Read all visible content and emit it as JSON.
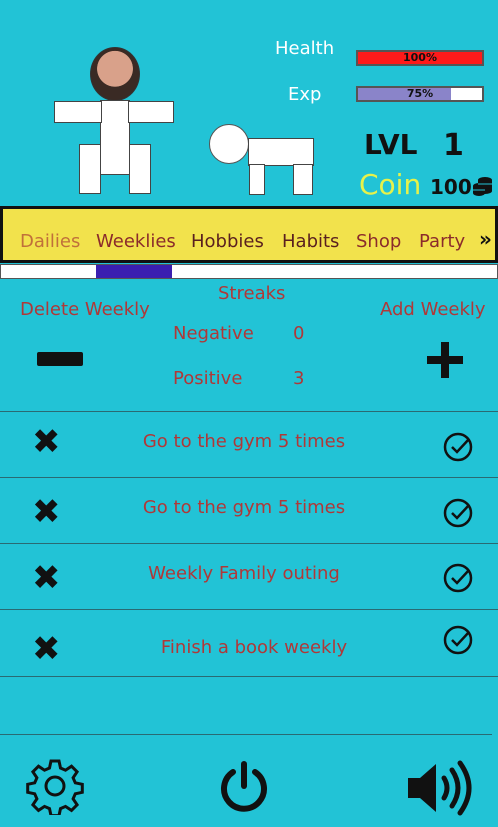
{
  "stats": {
    "health_label": "Health",
    "health_value": "100%",
    "health_fraction": 1.0,
    "health_color": "#ff1a1a",
    "exp_label": "Exp",
    "exp_value": "75%",
    "exp_fraction": 0.75,
    "exp_color": "#8a84c9",
    "level_label": "LVL",
    "level_value": "1",
    "coin_label": "Coin",
    "coin_value": "100"
  },
  "tabs": [
    "Dailies",
    "Weeklies",
    "Hobbies",
    "Habits",
    "Shop",
    "Party"
  ],
  "tabs_more": "»",
  "panel": {
    "delete_label": "Delete Weekly",
    "add_label": "Add Weekly",
    "streaks_title": "Streaks",
    "negative_label": "Negative",
    "negative_value": "0",
    "positive_label": "Positive",
    "positive_value": "3"
  },
  "weeklies": [
    "Go to the gym 5 times",
    "Go to the gym 5 times",
    "Weekly Family outing",
    "Finish a book weekly"
  ],
  "colors": {
    "background": "#22c3d6",
    "tab_bar": "#f2e24c",
    "active_tab_indicator": "#3a1fb0",
    "text_red": "#b03838"
  }
}
